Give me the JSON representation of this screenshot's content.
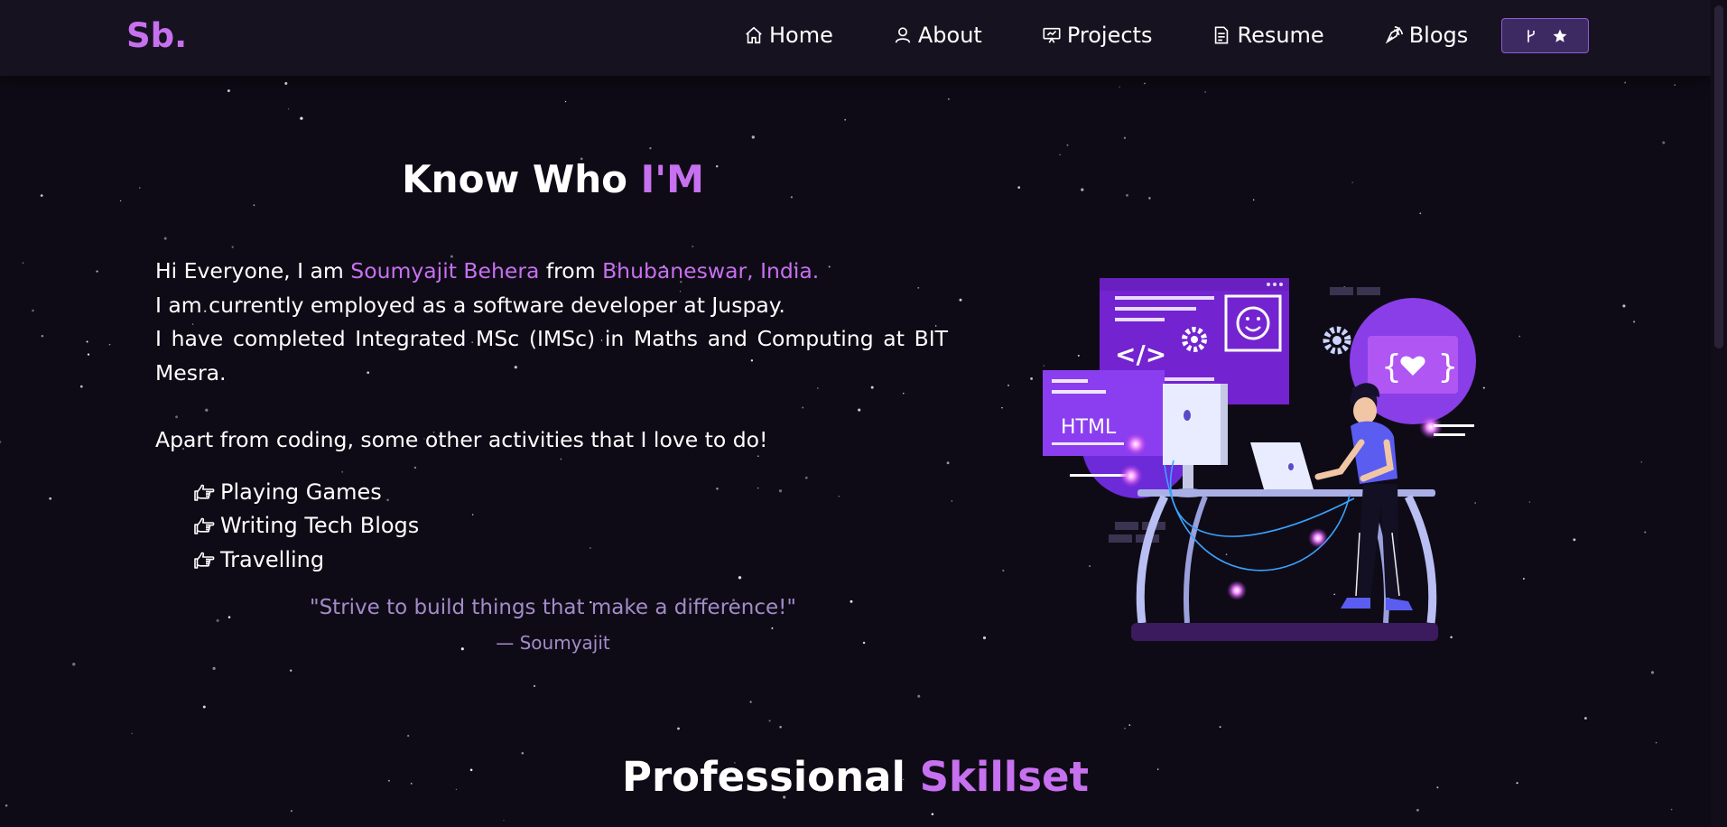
{
  "brand": {
    "logo": "Sb."
  },
  "nav": {
    "items": [
      {
        "label": "Home",
        "icon": "home-icon"
      },
      {
        "label": "About",
        "icon": "user-icon"
      },
      {
        "label": "Projects",
        "icon": "projects-icon"
      },
      {
        "label": "Resume",
        "icon": "document-icon"
      },
      {
        "label": "Blogs",
        "icon": "blog-pen-icon"
      }
    ],
    "github_button": {
      "icons": [
        "fork-icon",
        "star-icon"
      ]
    }
  },
  "about": {
    "title_prefix": "Know Who ",
    "title_highlight": "I'M",
    "intro_prefix": "Hi Everyone, I am ",
    "name": "Soumyajit Behera",
    "intro_mid": " from ",
    "location": "Bhubaneswar, India.",
    "line2": "I am currently employed as a software developer at Juspay.",
    "line3": "I have completed Integrated MSc (IMSc) in Maths and Computing at BIT Mesra.",
    "activities_intro": "Apart from coding, some other activities that I love to do!",
    "activities": [
      "Playing Games",
      "Writing Tech Blogs",
      "Travelling"
    ],
    "quote": "\"Strive to build things that make a difference!\"",
    "quote_author": "— Soumyajit"
  },
  "illustration": {
    "code_label": "HTML",
    "code_symbol": "</>",
    "braces_symbol": "{ }"
  },
  "skills": {
    "title_prefix": "Professional ",
    "title_highlight": "Skillset"
  },
  "colors": {
    "accent": "#c770f0",
    "background": "#0f0b16",
    "navbar": "#17121f",
    "quote": "#a48bc9"
  }
}
